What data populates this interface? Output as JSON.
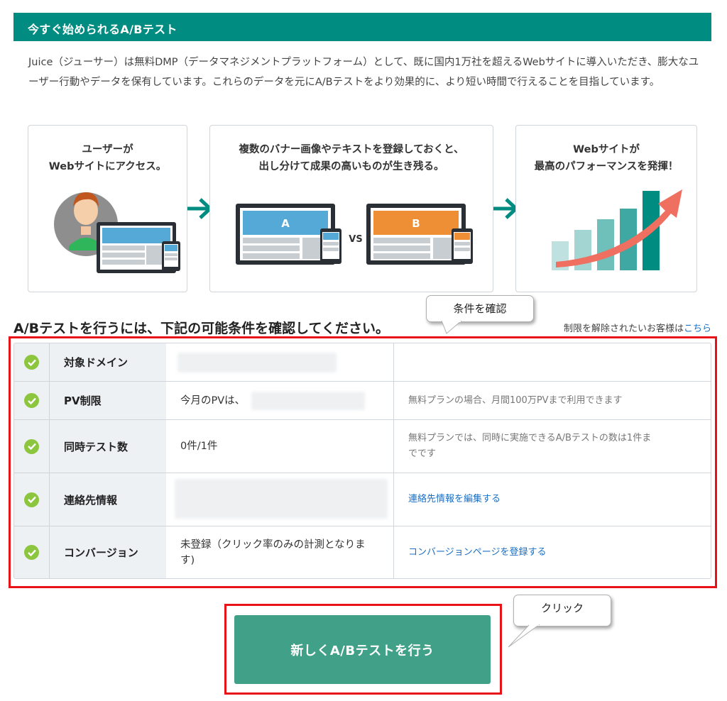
{
  "header": {
    "title": "今すぐ始められるA/Bテスト"
  },
  "intro": {
    "text": "Juice（ジューサー）は無料DMP（データマネジメントプラットフォーム）として、既に国内1万社を超えるWebサイトに導入いただき、膨大なユーザー行動やデータを保有しています。これらのデータを元にA/Bテストをより効果的に、より短い時間で行えることを目指しています。"
  },
  "steps": [
    {
      "line1": "ユーザーが",
      "line2": "Webサイトにアクセス。"
    },
    {
      "line1": "複数のバナー画像やテキストを登録しておくと、",
      "line2": "出し分けて成果の高いものが生き残る。",
      "label_a": "A",
      "label_b": "B",
      "vs": "VS"
    },
    {
      "line1": "Webサイトが",
      "line2": "最高のパフォーマンスを発揮！"
    }
  ],
  "section": {
    "title": "A/Bテストを行うには、下記の可能条件を確認してください。",
    "limit_note": "制限を解除されたいお客様は",
    "limit_link": "こちら"
  },
  "callouts": {
    "confirm": "条件を確認",
    "click": "クリック"
  },
  "conditions": [
    {
      "label": "対象ドメイン",
      "value": "",
      "note": "",
      "status": "ok"
    },
    {
      "label": "PV制限",
      "value": "今月のPVは、",
      "note": "無料プランの場合、月間100万PVまで利用できます",
      "status": "ok"
    },
    {
      "label": "同時テスト数",
      "value": "0件/1件",
      "note": "無料プランでは、同時に実施できるA/Bテストの数は1件までです",
      "status": "ok"
    },
    {
      "label": "連絡先情報",
      "value": "",
      "note": "連絡先情報を編集する",
      "status": "ok"
    },
    {
      "label": "コンバージョン",
      "value": "未登録（クリック率のみの計測となります)",
      "note": "コンバージョンページを登録する",
      "status": "ok"
    }
  ],
  "cta": {
    "label": "新しくA/Bテストを行う"
  },
  "colors": {
    "brand": "#008c80",
    "button": "#41a188",
    "check": "#8cc63f",
    "highlight": "#e81219",
    "link": "#1a6fc4"
  }
}
